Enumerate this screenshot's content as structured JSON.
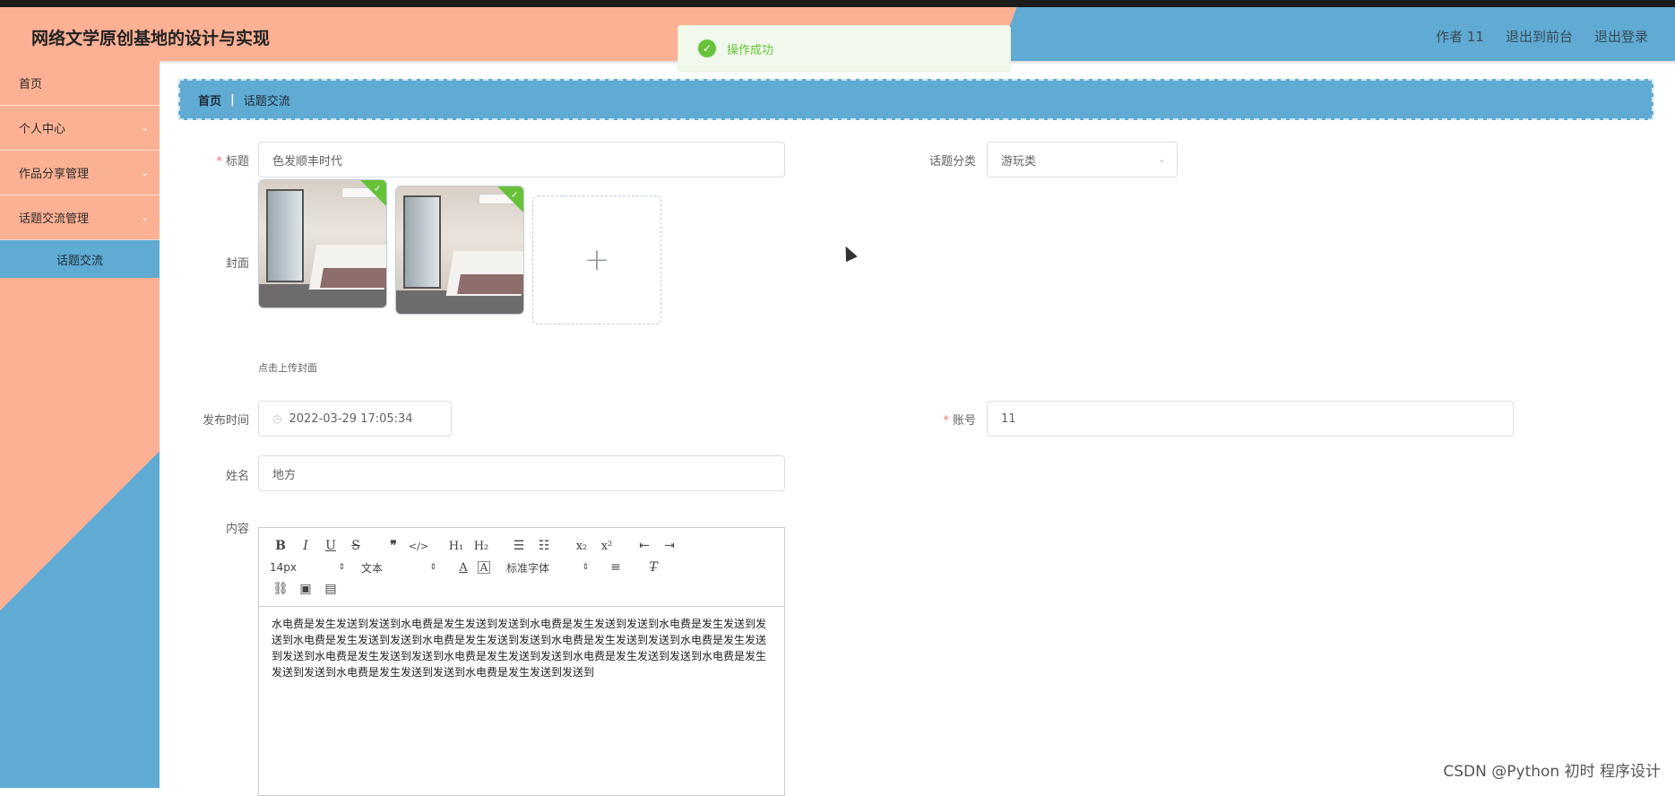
{
  "header": {
    "title": "网络文学原创基地的设计与实现",
    "user_label": "作者 11",
    "front_label": "退出到前台",
    "logout_label": "退出登录"
  },
  "toast": {
    "message": "操作成功"
  },
  "sidebar": {
    "items": [
      {
        "label": "首页"
      },
      {
        "label": "个人中心"
      },
      {
        "label": "作品分享管理"
      },
      {
        "label": "话题交流管理"
      }
    ],
    "active_sub": "话题交流"
  },
  "breadcrumb": {
    "home": "首页",
    "current": "话题交流"
  },
  "form": {
    "title_label": "标题",
    "title_value": "色发顺丰时代",
    "category_label": "话题分类",
    "category_value": "游玩类",
    "cover_label": "封面",
    "cover_hint": "点击上传封面",
    "cover_add": "+",
    "publish_label": "发布时间",
    "publish_value": "2022-03-29 17:05:34",
    "account_label": "账号",
    "account_value": "11",
    "name_label": "姓名",
    "name_value": "地方",
    "content_label": "内容"
  },
  "editor": {
    "font_size": "14px",
    "header_select": "文本",
    "font_family": "标准字体",
    "content": "水电费是发生发送到发送到水电费是发生发送到发送到水电费是发生发送到发送到水电费是发生发送到发送到水电费是发生发送到发送到水电费是发生发送到发送到水电费是发生发送到发送到水电费是发生发送到发送到水电费是发生发送到发送到水电费是发生发送到发送到水电费是发生发送到发送到水电费是发生发送到发送到水电费是发生发送到发送到水电费是发生发送到发送到"
  },
  "watermark": "CSDN @Python 初时 程序设计"
}
